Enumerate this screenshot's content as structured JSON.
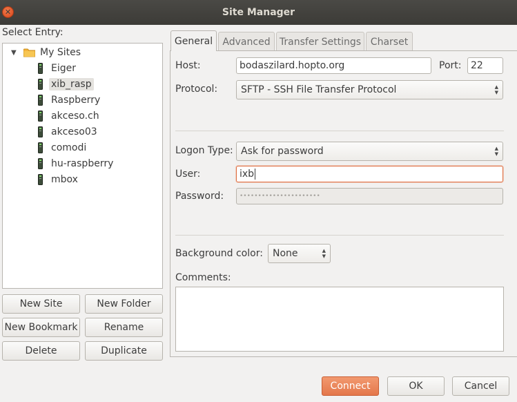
{
  "window": {
    "title": "Site Manager"
  },
  "left": {
    "select_entry_label": "Select Entry:",
    "root": {
      "label": "My Sites",
      "expanded": true
    },
    "sites": [
      {
        "label": "Eiger"
      },
      {
        "label": "xib_rasp",
        "selected": true
      },
      {
        "label": "Raspberry"
      },
      {
        "label": "akceso.ch"
      },
      {
        "label": "akceso03"
      },
      {
        "label": "comodi"
      },
      {
        "label": "hu-raspberry"
      },
      {
        "label": "mbox"
      }
    ],
    "buttons": {
      "new_site": "New Site",
      "new_folder": "New Folder",
      "new_bookmark": "New Bookmark",
      "rename": "Rename",
      "delete": "Delete",
      "duplicate": "Duplicate"
    }
  },
  "tabs": [
    "General",
    "Advanced",
    "Transfer Settings",
    "Charset"
  ],
  "active_tab": "General",
  "general": {
    "host_label": "Host:",
    "host_value": "bodaszilard.hopto.org",
    "port_label": "Port:",
    "port_value": "22",
    "protocol_label": "Protocol:",
    "protocol_value": "SFTP - SSH File Transfer Protocol",
    "logon_type_label": "Logon Type:",
    "logon_type_value": "Ask for password",
    "user_label": "User:",
    "user_value": "ixb",
    "password_label": "Password:",
    "password_value": "••••••••••••••••••••••",
    "background_color_label": "Background color:",
    "background_color_value": "None",
    "comments_label": "Comments:",
    "comments_value": ""
  },
  "footer": {
    "connect": "Connect",
    "ok": "OK",
    "cancel": "Cancel"
  },
  "colors": {
    "accent": "#e4774b",
    "titlebar": "#3c3b37",
    "focus_border": "#e06e41"
  },
  "icons": {
    "close": "close-icon",
    "folder": "folder-icon",
    "server": "server-icon",
    "expander": "triangle-down-icon",
    "updown": "updown-arrows-icon"
  }
}
